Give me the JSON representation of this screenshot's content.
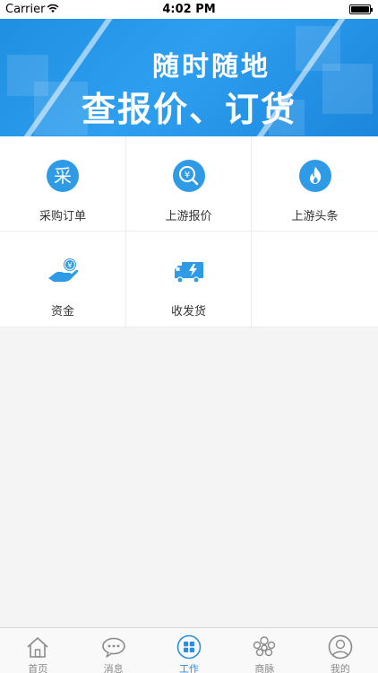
{
  "status_bar": {
    "carrier": "Carrier",
    "time": "4:02 PM"
  },
  "banner": {
    "line1": "随时随地",
    "line2": "查报价、订货"
  },
  "grid": {
    "items": [
      {
        "label": "采购订单",
        "icon": "purchase-order-icon",
        "glyph": "采"
      },
      {
        "label": "上游报价",
        "icon": "price-search-icon",
        "glyph": "¥"
      },
      {
        "label": "上游头条",
        "icon": "flame-icon"
      },
      {
        "label": "资金",
        "icon": "money-hand-icon",
        "glyph": "¥"
      },
      {
        "label": "收发货",
        "icon": "delivery-truck-icon"
      }
    ]
  },
  "tab_bar": {
    "tabs": [
      {
        "label": "首页",
        "icon": "home-icon",
        "active": false
      },
      {
        "label": "消息",
        "icon": "chat-bubble-icon",
        "active": false
      },
      {
        "label": "工作",
        "icon": "grid-apps-icon",
        "active": true
      },
      {
        "label": "商脉",
        "icon": "contacts-icon",
        "active": false
      },
      {
        "label": "我的",
        "icon": "profile-icon",
        "active": false
      }
    ]
  },
  "colors": {
    "accent": "#2a8ee8",
    "banner": "#2e9ff0",
    "icon_blue": "#2f9be6",
    "inactive": "#8a8a8a"
  }
}
